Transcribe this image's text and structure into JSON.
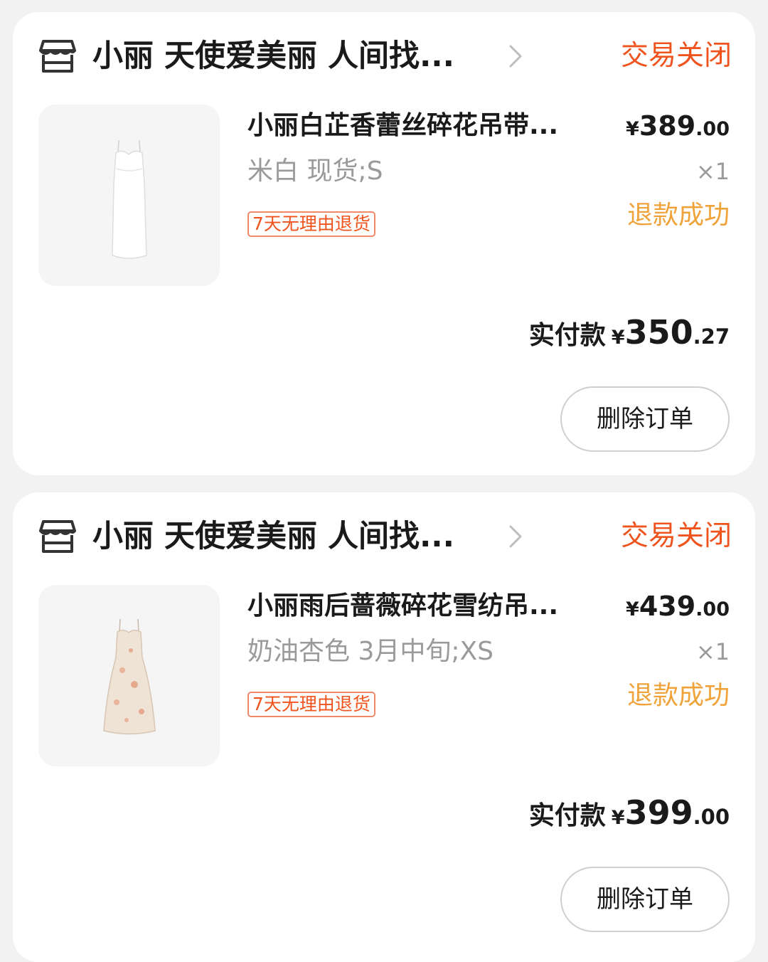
{
  "orders": [
    {
      "shop_name": "小丽 天使爱美丽 人间找...",
      "status": "交易关闭",
      "product": {
        "title": "小丽白芷香蕾丝碎花吊带...",
        "spec": "米白 现货;S",
        "badge": "7天无理由退货",
        "price_symbol": "¥",
        "price_integer": "389",
        "price_decimal": ".00",
        "quantity": "×1",
        "refund_status": "退款成功"
      },
      "paid_label": "实付款",
      "paid_symbol": "¥",
      "paid_integer": "350",
      "paid_decimal": ".27",
      "delete_label": "删除订单"
    },
    {
      "shop_name": "小丽 天使爱美丽 人间找...",
      "status": "交易关闭",
      "product": {
        "title": "小丽雨后蔷薇碎花雪纺吊...",
        "spec": "奶油杏色 3月中旬;XS",
        "badge": "7天无理由退货",
        "price_symbol": "¥",
        "price_integer": "439",
        "price_decimal": ".00",
        "quantity": "×1",
        "refund_status": "退款成功"
      },
      "paid_label": "实付款",
      "paid_symbol": "¥",
      "paid_integer": "399",
      "paid_decimal": ".00",
      "delete_label": "删除订单"
    }
  ],
  "icons": {
    "shop": "store-icon",
    "chevron": "chevron-right-icon"
  },
  "colors": {
    "status_orange": "#f0541e",
    "refund_amber": "#f0a33a",
    "muted_text": "#9a9a9a",
    "page_background": "#f2f2f2"
  }
}
